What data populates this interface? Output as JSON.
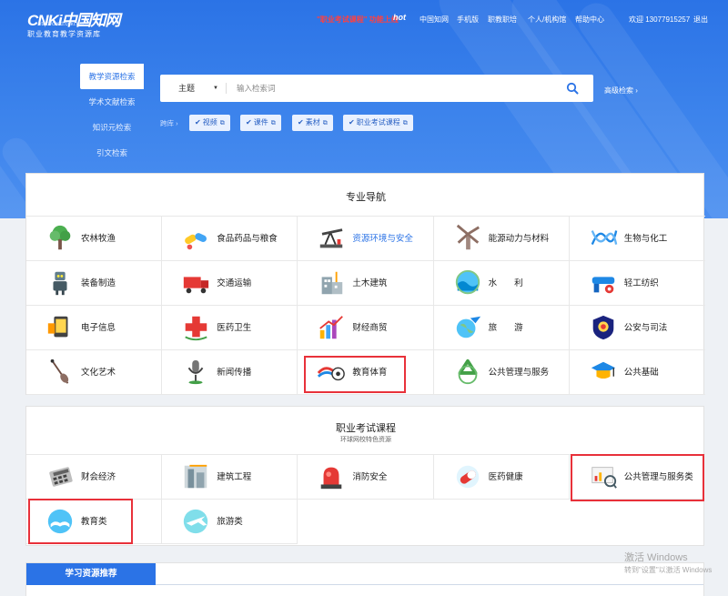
{
  "header": {
    "logo_mark": "CNKi中国知网",
    "logo_url": "http://cved.cnki.net",
    "logo_sub": "职业教育教学资源库",
    "promo_text": "\"职业考试课程\" 功能上线",
    "hot": "hot",
    "nav": [
      "中国知网",
      "手机版",
      "职教职培",
      "个人/机构馆",
      "帮助中心"
    ],
    "welcome": "欢迎 13077915257",
    "logout": "退出"
  },
  "search": {
    "tabs": [
      "教学资源检索",
      "学术文献检索",
      "知识元检索",
      "引文检索"
    ],
    "field": "主题",
    "placeholder": "输入检索词",
    "advanced": "高级检索",
    "lib_label": "跨库",
    "chips": [
      "视频",
      "课件",
      "素材",
      "职业考试课程"
    ]
  },
  "major_nav": {
    "title": "专业导航",
    "items": [
      {
        "label": "农林牧渔",
        "icon": "tree-icon"
      },
      {
        "label": "食品药品与粮食",
        "icon": "pills-icon"
      },
      {
        "label": "资源环境与安全",
        "icon": "oil-pump-icon",
        "highlight": true
      },
      {
        "label": "能源动力与材料",
        "icon": "windmill-icon"
      },
      {
        "label": "生物与化工",
        "icon": "dna-icon"
      },
      {
        "label": "装备制造",
        "icon": "robot-icon"
      },
      {
        "label": "交通运输",
        "icon": "truck-icon"
      },
      {
        "label": "土木建筑",
        "icon": "building-icon"
      },
      {
        "label": "水　　利",
        "icon": "water-icon"
      },
      {
        "label": "轻工纺织",
        "icon": "sewing-machine-icon"
      },
      {
        "label": "电子信息",
        "icon": "electronics-icon"
      },
      {
        "label": "医药卫生",
        "icon": "medical-cross-icon"
      },
      {
        "label": "财经商贸",
        "icon": "chart-icon"
      },
      {
        "label": "旅　　游",
        "icon": "globe-plane-icon"
      },
      {
        "label": "公安与司法",
        "icon": "police-badge-icon"
      },
      {
        "label": "文化艺术",
        "icon": "violin-icon"
      },
      {
        "label": "新闻传播",
        "icon": "microphone-icon"
      },
      {
        "label": "教育体育",
        "icon": "soccer-icon"
      },
      {
        "label": "公共管理与服务",
        "icon": "recycle-icon"
      },
      {
        "label": "公共基础",
        "icon": "graduation-cap-icon"
      }
    ]
  },
  "exam_courses": {
    "title": "职业考试课程",
    "subtitle": "环球网校特色资源",
    "items": [
      {
        "label": "财会经济",
        "icon": "calculator-icon"
      },
      {
        "label": "建筑工程",
        "icon": "crane-icon"
      },
      {
        "label": "消防安全",
        "icon": "siren-icon"
      },
      {
        "label": "医药健康",
        "icon": "capsule-icon"
      },
      {
        "label": "公共管理与服务类",
        "icon": "analysis-board-icon"
      },
      {
        "label": "教育类",
        "icon": "open-book-icon"
      },
      {
        "label": "旅游类",
        "icon": "plane-icon"
      }
    ]
  },
  "recommend": {
    "title": "学习资源推荐"
  },
  "watermark": {
    "line1": "激活 Windows",
    "line2": "转到\"设置\"以激活 Windows"
  },
  "colors": {
    "header_blue": "#2b73e6",
    "highlight_red": "#e8313a"
  }
}
